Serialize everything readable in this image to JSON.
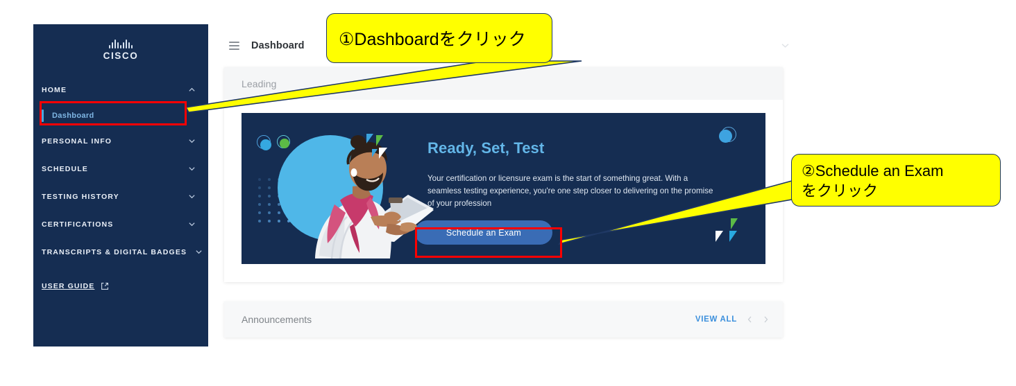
{
  "sidebar": {
    "logo": {
      "icon": "cisco-bars-icon",
      "wordmark": "CISCO"
    },
    "sections": [
      {
        "label": "HOME",
        "chevron": "chevron-up-icon",
        "expanded": true
      },
      {
        "label": "PERSONAL INFO",
        "chevron": "chevron-down-icon",
        "expanded": false
      },
      {
        "label": "SCHEDULE",
        "chevron": "chevron-down-icon",
        "expanded": false
      },
      {
        "label": "TESTING HISTORY",
        "chevron": "chevron-down-icon",
        "expanded": false
      },
      {
        "label": "CERTIFICATIONS",
        "chevron": "chevron-down-icon",
        "expanded": false
      },
      {
        "label": "TRANSCRIPTS & DIGITAL BADGES",
        "chevron": "chevron-down-icon",
        "expanded": false
      }
    ],
    "active_item": "Dashboard",
    "user_guide": {
      "label": "USER GUIDE",
      "icon": "external-link-icon"
    }
  },
  "topbar": {
    "menu_icon": "hamburger-icon",
    "title": "Dashboard",
    "collapse_icon": "chevron-down-icon"
  },
  "leading_card": {
    "title": "Leading"
  },
  "hero": {
    "title": "Ready, Set, Test",
    "body": "Your certification or licensure exam is the start of something great. With a seamless testing experience, you're one step closer to delivering on the promise of your profession",
    "cta_label": "Schedule an Exam"
  },
  "announcements": {
    "title": "Announcements",
    "view_all_label": "VIEW ALL",
    "prev_icon": "chevron-left-icon",
    "next_icon": "chevron-right-icon"
  },
  "annotations": {
    "callout_1": "①Dashboardをクリック",
    "callout_2_line1": "②Schedule an Exam",
    "callout_2_line2": "をクリック"
  },
  "colors": {
    "sidebar_navy": "#152d52",
    "hero_navy": "#152d52",
    "accent_blue": "#4aa8e0",
    "hero_title_blue": "#63b6e8",
    "cta_blue": "#3a6cb5",
    "link_blue": "#3b8fdc",
    "callout_yellow": "#ffff00",
    "callout_border": "#1f3864",
    "highlight_red": "#ff0000"
  }
}
